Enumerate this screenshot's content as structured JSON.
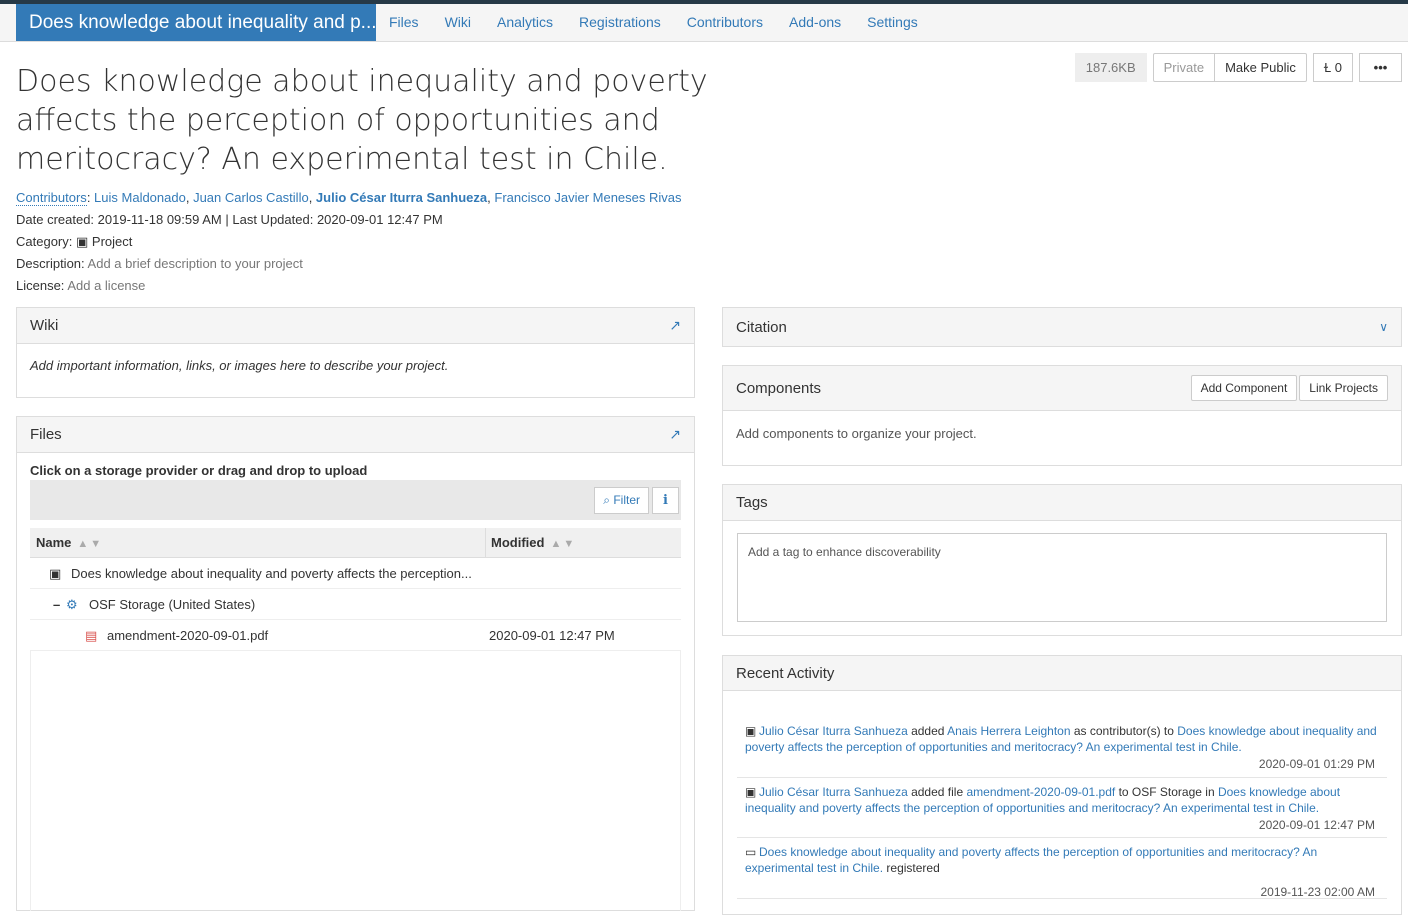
{
  "navbar": {
    "project_title": "Does knowledge about inequality and p...",
    "items": [
      "Files",
      "Wiki",
      "Analytics",
      "Registrations",
      "Contributors",
      "Add-ons",
      "Settings"
    ]
  },
  "header": {
    "title": "Does knowledge about inequality and poverty affects the perception of opportunities and meritocracy? An experimental test in Chile.",
    "size": "187.6KB",
    "private_label": "Private",
    "make_public_label": "Make Public",
    "fork_count": "0",
    "more_label": "•••"
  },
  "meta": {
    "contributors_label": "Contributors",
    "contributors": [
      "Luis Maldonado",
      "Juan Carlos Castillo",
      "Julio César Iturra Sanhueza",
      "Francisco Javier Meneses Rivas"
    ],
    "date_created_label": "Date created:",
    "date_created": "2019-11-18 09:59 AM",
    "last_updated_label": "Last Updated:",
    "last_updated": "2020-09-01 12:47 PM",
    "category_label": "Category:",
    "category": "Project",
    "description_label": "Description:",
    "description_placeholder": "Add a brief description to your project",
    "license_label": "License:",
    "license_placeholder": "Add a license"
  },
  "wiki": {
    "title": "Wiki",
    "body": "Add important information, links, or images here to describe your project."
  },
  "files": {
    "title": "Files",
    "hint": "Click on a storage provider or drag and drop to upload",
    "filter_label": "Filter",
    "info_label": "i",
    "columns": [
      "Name",
      "Modified"
    ],
    "rows": [
      {
        "name": "Does knowledge about inequality and poverty affects the perception...",
        "modified": ""
      },
      {
        "name": "OSF Storage (United States)",
        "modified": ""
      },
      {
        "name": "amendment-2020-09-01.pdf",
        "modified": "2020-09-01 12:47 PM"
      }
    ]
  },
  "citation": {
    "title": "Citation"
  },
  "components": {
    "title": "Components",
    "add_label": "Add Component",
    "link_label": "Link Projects",
    "body": "Add components to organize your project."
  },
  "tags": {
    "title": "Tags",
    "placeholder": "Add a tag to enhance discoverability"
  },
  "activity": {
    "title": "Recent Activity",
    "items": [
      {
        "user": "Julio César Iturra Sanhueza",
        "verb": " added ",
        "target": "Anais Herrera Leighton",
        "mid": " as contributor(s) to ",
        "project": "Does knowledge about inequality and poverty affects the perception of opportunities and meritocracy? An experimental test in Chile.",
        "time": "2020-09-01 01:29 PM"
      },
      {
        "user": "Julio César Iturra Sanhueza",
        "verb": " added file ",
        "target": "amendment-2020-09-01.pdf",
        "mid": " to OSF Storage in ",
        "project": "Does knowledge about inequality and poverty affects the perception of opportunities and meritocracy? An experimental test in Chile.",
        "time": "2020-09-01 12:47 PM"
      },
      {
        "project": "Does knowledge about inequality and poverty affects the perception of opportunities and meritocracy? An experimental test in Chile.",
        "suffix": " registered",
        "time": "2019-11-23 02:00 AM"
      }
    ]
  }
}
